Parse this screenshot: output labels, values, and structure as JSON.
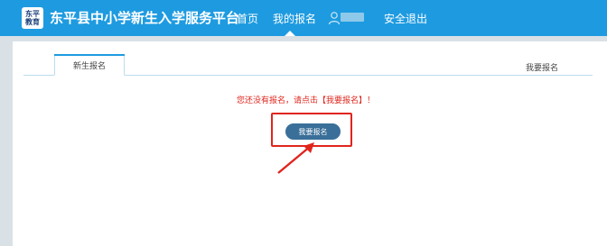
{
  "header": {
    "logo_line1": "东平",
    "logo_line2": "教育",
    "site_title": "东平县中小学新生入学服务平台",
    "nav": {
      "home": "首页",
      "my_registration": "我的报名",
      "logout": "安全退出"
    },
    "icons": {
      "user": "user-icon"
    }
  },
  "tabs": {
    "active": "新生报名",
    "right_link": "我要报名"
  },
  "main": {
    "notice": "您还没有报名，请点击【我要报名】！",
    "signup_button": "我要报名"
  },
  "colors": {
    "header_bg": "#1e9be0",
    "notice": "#e0251c",
    "button_bg": "#3a6f99",
    "page_bg": "#d9e1e6",
    "annotation": "#e0251c"
  }
}
